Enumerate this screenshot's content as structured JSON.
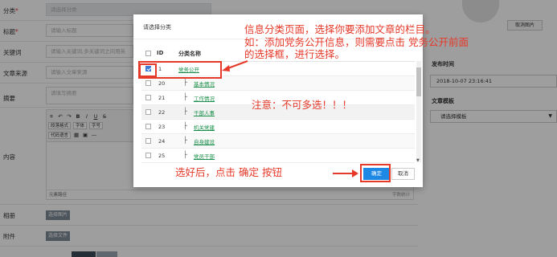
{
  "form": {
    "category_label": "分类",
    "required_mark": "*",
    "category_placeholder": "请选择分类",
    "title_label": "标题",
    "title_placeholder": "请输入标题",
    "keywords_label": "关键词",
    "keywords_placeholder": "请输入关键词,多关键词之间用英",
    "source_label": "文章来源",
    "source_placeholder": "请输入文章来源",
    "summary_label": "摘要",
    "summary_placeholder": "请填写摘要",
    "content_label": "内容",
    "gallery_label": "相册",
    "gallery_button": "选择图片",
    "attachment_label": "附件",
    "attachment_button": "选择文件"
  },
  "editor": {
    "paragraph_format": "段落格式",
    "font_family": "字体",
    "font_size": "字号",
    "code_language": "代码语言",
    "bold": "B",
    "italic": "I",
    "underline": "U",
    "element_path": "元素路径",
    "word_count": "字数统计"
  },
  "right_panel": {
    "cancel_image_button": "取消图片",
    "publish_time_label": "发布时间",
    "publish_time_value": "2018-10-07 23:16:41",
    "template_label": "文章模板",
    "template_value": "请选择模板",
    "colors": {
      "panel_border": "#cccccc"
    }
  },
  "modal": {
    "title": "请选择分类",
    "columns": [
      "ID",
      "分类名称"
    ],
    "rows": [
      {
        "id": "1",
        "name": "党务公开",
        "checked": true,
        "level": 0
      },
      {
        "id": "20",
        "name": "基本情况",
        "checked": false,
        "level": 1
      },
      {
        "id": "21",
        "name": "工作情况",
        "checked": false,
        "level": 1
      },
      {
        "id": "22",
        "name": "干部人事",
        "checked": false,
        "level": 1
      },
      {
        "id": "23",
        "name": "机关党建",
        "checked": false,
        "level": 1
      },
      {
        "id": "24",
        "name": "自身建设",
        "checked": false,
        "level": 1
      },
      {
        "id": "25",
        "name": "党员干部",
        "checked": false,
        "level": 1
      }
    ],
    "ok_button": "确定",
    "cancel_button": "取消",
    "colors": {
      "link": "#1a8f4a",
      "ok_button": "#1e88e5"
    }
  },
  "annotations": {
    "main_line1": "信息分类页面，选择你要添加文章的栏目。",
    "main_line2": "如：添加党务公开信息，则需要点击 党务公开前面",
    "main_line3": "的选择框，进行选择。",
    "note": "注意：不可多选！！！",
    "bottom": "选好后，点击 确定 按钮",
    "color": "#e53929"
  }
}
